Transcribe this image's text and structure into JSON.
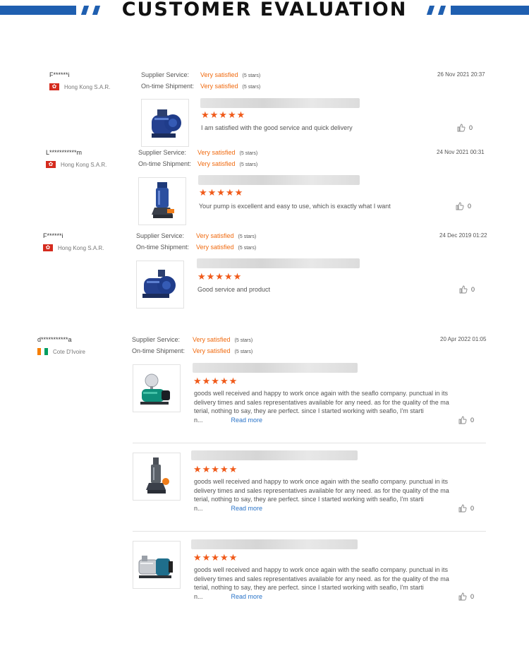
{
  "page": {
    "title": "CUSTOMER EVALUATION"
  },
  "colors": {
    "accent_blue": "#1f5fb0",
    "rating_orange": "#f06a0f",
    "star_orange": "#f05a1a",
    "link_blue": "#2a74c9"
  },
  "labels": {
    "supplier_service": "Supplier Service:",
    "ontime_shipment": "On-time Shipment:",
    "read_more": "Read more",
    "stars_glyph": "★★★★★"
  },
  "reviews": [
    {
      "name": "F******i",
      "country": "Hong Kong S.A.R.",
      "flag": "hk",
      "supplier_rating": "Very satisfied",
      "supplier_stars": "(5 stars)",
      "shipment_rating": "Very satisfied",
      "shipment_stars": "(5 stars)",
      "date": "26 Nov 2021 20:37",
      "items": [
        {
          "image": "pump-icon",
          "comment": "I am satisfied with the good service and quick delivery",
          "likes": "0"
        }
      ]
    },
    {
      "name": "L***********m",
      "country": "Hong Kong S.A.R.",
      "flag": "hk",
      "supplier_rating": "Very satisfied",
      "supplier_stars": "(5 stars)",
      "shipment_rating": "Very satisfied",
      "shipment_stars": "(5 stars)",
      "date": "24 Nov 2021 00:31",
      "items": [
        {
          "image": "submersible-pump-icon",
          "comment": "Your pump is excellent and easy to use, which is exactly what I want",
          "likes": "0"
        }
      ]
    },
    {
      "name": "F******i",
      "country": "Hong Kong S.A.R.",
      "flag": "hk",
      "supplier_rating": "Very satisfied",
      "supplier_stars": "(5 stars)",
      "shipment_rating": "Very satisfied",
      "shipment_stars": "(5 stars)",
      "date": "24 Dec 2019 01:22",
      "items": [
        {
          "image": "pump-icon",
          "comment": "Good service and product",
          "likes": "0"
        }
      ]
    },
    {
      "name": "d***********a",
      "country": "Cote D'Ivoire",
      "flag": "ci",
      "supplier_rating": "Very satisfied",
      "supplier_stars": "(5 stars)",
      "shipment_rating": "Very satisfied",
      "shipment_stars": "(5 stars)",
      "date": "20 Apr 2022 01:05",
      "items": [
        {
          "image": "booster-pump-icon",
          "lines": [
            "goods well received and happy to work once again with the seaflo company.  punctual in its",
            "delivery times and sales representatives available for any need.  as for the quality of the ma",
            "terial, nothing to say, they are perfect.  since I started working with seaflo, I'm starti",
            "n..."
          ],
          "likes": "0"
        },
        {
          "image": "submersible-pump-icon",
          "lines": [
            "goods well received and happy to work once again with the seaflo company.  punctual in its",
            "delivery times and sales representatives available for any need.  as for the quality of the ma",
            "terial, nothing to say, they are perfect.  since I started working with seaflo, I'm starti",
            "n..."
          ],
          "likes": "0"
        },
        {
          "image": "jet-pump-icon",
          "lines": [
            "goods well received and happy to work once again with the seaflo company.  punctual in its",
            "delivery times and sales representatives available for any need.  as for the quality of the ma",
            "terial, nothing to say, they are perfect.  since I started working with seaflo, I'm starti",
            "n..."
          ],
          "likes": "0"
        }
      ]
    }
  ]
}
